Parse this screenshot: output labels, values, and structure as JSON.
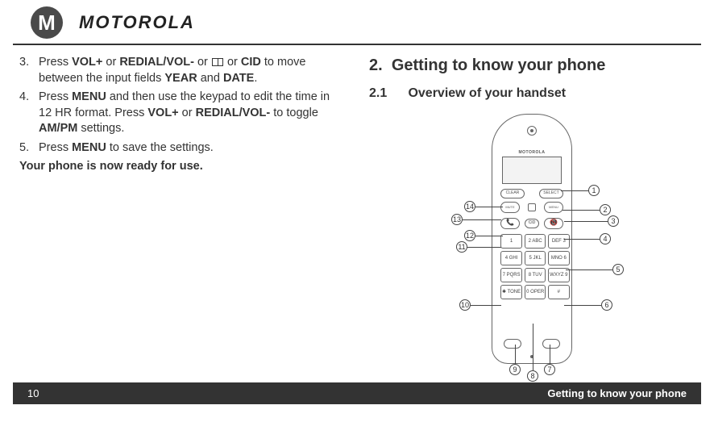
{
  "brand": {
    "logo_glyph": "M",
    "wordmark": "MOTOROLA"
  },
  "left": {
    "items": [
      {
        "num": "3.",
        "seg": [
          "Press ",
          "VOL+",
          " or ",
          "REDIAL/VOL-",
          " or ",
          "__BOOK__",
          " or ",
          "CID",
          " to move between the input fields ",
          "YEAR",
          " and ",
          "DATE",
          "."
        ]
      },
      {
        "num": "4.",
        "seg": [
          "Press ",
          "MENU",
          " and then use the keypad to edit the time in 12 HR format. Press ",
          "VOL+",
          " or ",
          "REDIAL/VOL-",
          " to toggle ",
          "AM/PM",
          " settings."
        ]
      },
      {
        "num": "5.",
        "seg": [
          "Press ",
          "MENU",
          " to save the settings."
        ]
      }
    ],
    "ready": "Your phone is now ready for use."
  },
  "right": {
    "h2_num": "2.",
    "h2_text": "Getting to know your phone",
    "h3_num": "2.1",
    "h3_text": "Overview of your handset"
  },
  "phone": {
    "brand_small": "MOTOROLA",
    "soft_left": "CLEAR",
    "soft_right": "SELECT",
    "nav_left": "MUTE",
    "nav_right": "MENU",
    "call_mid": "CID",
    "keys": [
      "1",
      "2 ABC",
      "DEF 3",
      "4 GHI",
      "5 JKL",
      "MNO 6",
      "7 PQRS",
      "8 TUV",
      "WXYZ 9",
      "✱ TONE",
      "0 OPER",
      "#"
    ]
  },
  "callouts": {
    "1": "1",
    "2": "2",
    "3": "3",
    "4": "4",
    "5": "5",
    "6": "6",
    "7": "7",
    "8": "8",
    "9": "9",
    "10": "10",
    "11": "11",
    "12": "12",
    "13": "13",
    "14": "14"
  },
  "footer": {
    "page": "10",
    "section": "Getting to know your phone"
  }
}
